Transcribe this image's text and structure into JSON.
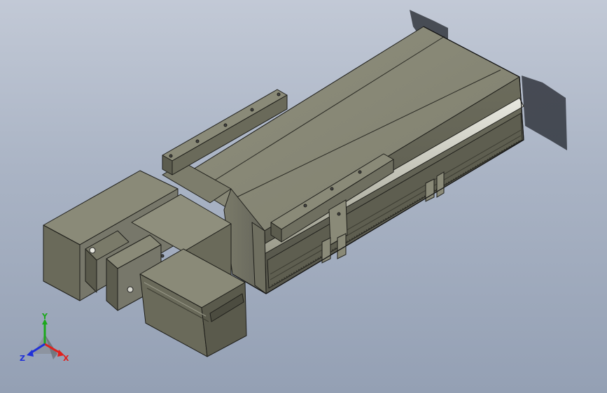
{
  "viewport": {
    "background_top": "#c2c9d6",
    "background_bottom": "#94a0b4"
  },
  "model": {
    "body_color": "#8a8a78",
    "dark_color": "#5a5a4c",
    "light_color": "#a8a894",
    "edge_color": "#1e1e1a"
  },
  "triad": {
    "x_label": "X",
    "y_label": "Y",
    "z_label": "Z",
    "x_color": "#e0201c",
    "y_color": "#1ca81c",
    "z_color": "#2030d8"
  }
}
